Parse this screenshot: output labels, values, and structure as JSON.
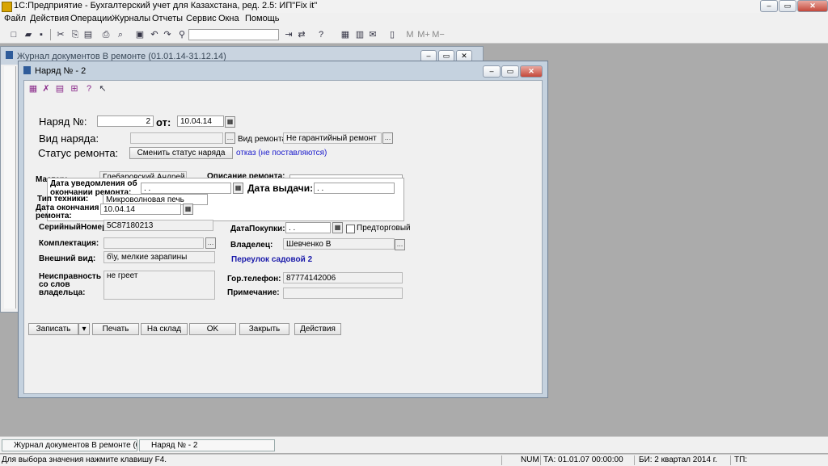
{
  "app": {
    "title": "1С:Предприятие - Бухгалтерский учет для Казахстана, ред. 2.5: ИП\"Fix it\"",
    "window_buttons": {
      "minimize": "–",
      "restore": "▭",
      "close": "✕"
    }
  },
  "menu": [
    "Файл",
    "Действия",
    "Операции",
    "Журналы",
    "Отчеты",
    "Сервис",
    "Окна",
    "Помощь"
  ],
  "toolbar": {
    "m": "M",
    "m_plus": "M+",
    "m_minus": "M−"
  },
  "journal": {
    "title": "Журнал документов  В ремонте (01.01.14-31.12.14)"
  },
  "dialog": {
    "title": "Наряд № - 2",
    "order_no_label": "Наряд №:",
    "order_no": "2",
    "from_label": "от:",
    "date": "10.04.14",
    "type_label": "Вид наряда:",
    "repair_type_label": "Вид ремонта:",
    "repair_type": "Не гарантийный ремонт",
    "status_label": "Статус ремонта:",
    "change_status": "Сменить статус наряда",
    "status_note": "отказ (не поставляются)",
    "master_label": "Мастер:",
    "master": "Глебаровский Андрей А.",
    "repair_desc_label": "Описание ремонта:",
    "notify_label_1": "Дата уведомления об",
    "notify_label_2": "окончании ремонта:",
    "notify_value": " .  .",
    "issue_label": "Дата выдачи:",
    "issue_value": " .  .",
    "device_type_label": "Тип техники:",
    "device_type": "Микроволновая печь",
    "end_label_1": "Дата окончания",
    "end_label_2": "ремонта:",
    "end_date": "10.04.14",
    "serial_label": "СерийныйНомер:",
    "serial": "5C87180213",
    "purchase_label": "ДатаПокупки:",
    "purchase_date": " .  .",
    "pretrade_label": "Предторговый",
    "kit_label": "Комплектация:",
    "owner_label": "Владелец:",
    "owner": "Шевченко В",
    "address": "Переулок садовой 2",
    "look_label": "Внешний вид:",
    "look": "б\\у, мелкие зарапины",
    "fault_label_1": "Неисправность",
    "fault_label_2": "со слов",
    "fault_label_3": "владельца:",
    "fault": "не греет",
    "phone_label": "Гор.телефон:",
    "phone": "87774142006",
    "note_label": "Примечание:",
    "buttons": {
      "save": "Записать",
      "print": "Печать",
      "to_stock": "На склад",
      "ok": "OK",
      "close": "Закрыть",
      "actions": "Действия"
    }
  },
  "taskbar": [
    "Журнал документов  В ремонте (01....",
    "Наряд № - 2"
  ],
  "status": {
    "hint": "Для выбора значения нажмите клавишу F4.",
    "num": "NUM",
    "ta": "ТА: 01.01.07  00:00:00",
    "bi": "БИ: 2 квартал 2014 г.",
    "tp": "ТП:"
  }
}
